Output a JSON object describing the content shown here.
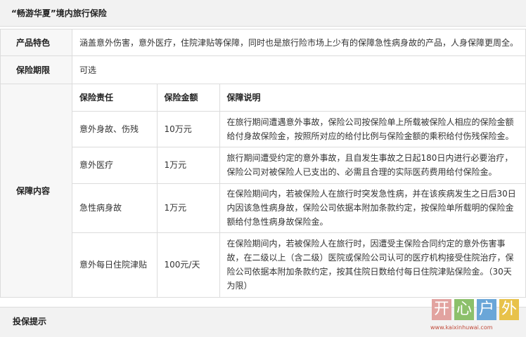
{
  "title": "“畅游华夏”境内旅行保险",
  "rows": {
    "features": {
      "label": "产品特色",
      "value": "涵盖意外伤害，意外医疗，住院津贴等保障，同时也是旅行险市场上少有的保障急性病身故的产品，人身保障更周全。"
    },
    "period": {
      "label": "保险期限",
      "value": "可选"
    },
    "coverage": {
      "label": "保障内容",
      "headers": [
        "保险责任",
        "保险金额",
        "保障说明"
      ],
      "items": [
        {
          "name": "意外身故、伤残",
          "amount": "10万元",
          "desc": "在旅行期间遭遇意外事故，保险公司按保险单上所载被保险人相应的保险金额给付身故保险金，按照所对应的给付比例与保险金额的乘积给付伤残保险金。"
        },
        {
          "name": "意外医疗",
          "amount": "1万元",
          "desc": "旅行期间遭受约定的意外事故，且自发生事故之日起180日内进行必要治疗，保险公司对被保险人已支出的、必需且合理的实际医药费用给付保险金。"
        },
        {
          "name": "急性病身故",
          "amount": "1万元",
          "desc": "在保险期间内，若被保险人在旅行时突发急性病，并在该疾病发生之日后30日内因该急性病身故，保险公司依据本附加条款约定，按保险单所载明的保险金额给付急性病身故保险金。"
        },
        {
          "name": "意外每日住院津贴",
          "amount": "100元/天",
          "desc": "在保险期间内，若被保险人在旅行时，因遭受主保险合同约定的意外伤害事故，在二级以上（含二级）医院或保险公司认可的医疗机构接受住院治疗，保险公司依据本附加条款约定，按其住院日数给付每日住院津贴保险金。（30天为限）"
        }
      ]
    }
  },
  "footer": "投保提示",
  "watermark": {
    "chars": [
      "开",
      "心",
      "户",
      "外"
    ],
    "colors": [
      "#e2a3a0",
      "#8cc06b",
      "#6aa6d8",
      "#e8c24a"
    ],
    "url": "www.kaixinhuwai.com"
  }
}
